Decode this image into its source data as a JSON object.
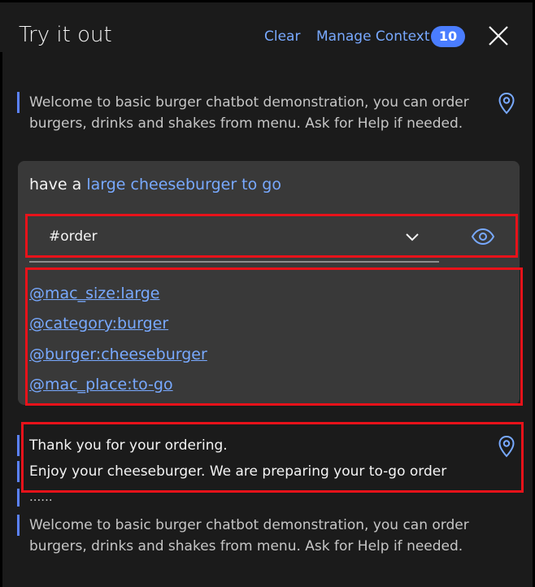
{
  "header": {
    "title": "Try it out",
    "clear_label": "Clear",
    "manage_label": "Manage Context",
    "context_count": "10"
  },
  "messages": {
    "welcome_1_line1": "Welcome to basic burger chatbot demonstration, you can order",
    "welcome_1_line2": "burgers, drinks and shakes from menu. Ask for Help if needed."
  },
  "user_input": {
    "prefix": "have a ",
    "highlight": "large cheeseburger to go"
  },
  "intent": {
    "value": "#order"
  },
  "entities": [
    "@mac_size:large",
    "@category:burger",
    "@burger:cheeseburger",
    "@mac_place:to-go"
  ],
  "responses": {
    "line1": "Thank you for your ordering.",
    "line2": "Enjoy your cheeseburger. We are preparing your to-go order",
    "ellipsis": "......",
    "welcome_2_line1": "Welcome to basic burger chatbot demonstration, you can order",
    "welcome_2_line2": "burgers, drinks and shakes from menu. Ask for Help if needed."
  },
  "colors": {
    "background": "#1b1b1b",
    "card": "#393939",
    "link": "#78a9ff",
    "accent_bar": "#5b82ff",
    "highlight_border": "#e8121a"
  },
  "icons": {
    "close": "close-icon",
    "location": "location-pin-icon",
    "chevron": "chevron-down-icon",
    "view": "eye-icon"
  }
}
